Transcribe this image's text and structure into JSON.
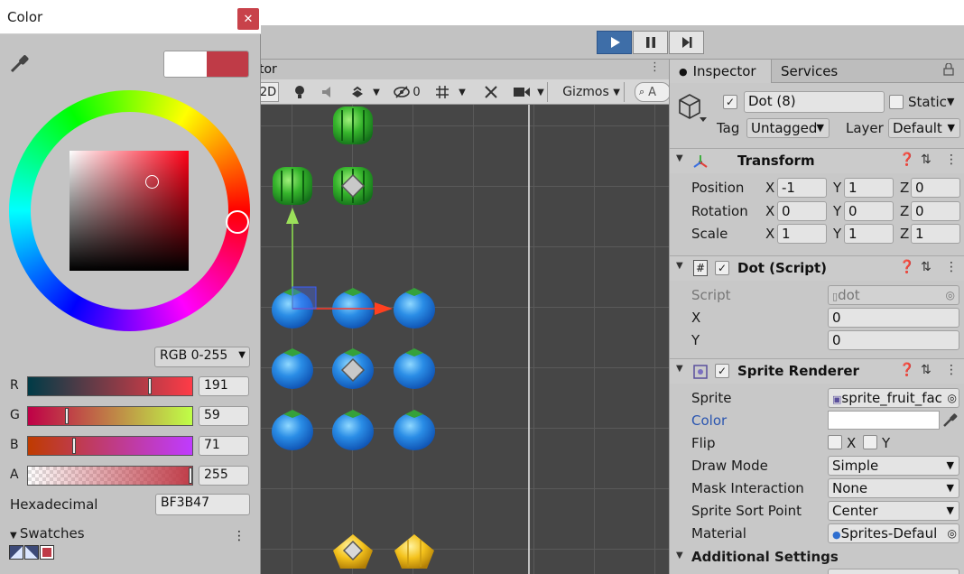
{
  "color_window": {
    "title": "Color",
    "current_color": "#BF3B47",
    "previous_color": "#FFFFFF",
    "mode": "RGB 0-255",
    "channels": [
      {
        "label": "R",
        "value": "191",
        "fraction": 0.749
      },
      {
        "label": "G",
        "value": "59",
        "fraction": 0.231
      },
      {
        "label": "B",
        "value": "71",
        "fraction": 0.278
      },
      {
        "label": "A",
        "value": "255",
        "fraction": 1.0
      }
    ],
    "hex_label": "Hexadecimal",
    "hex_value": "BF3B47",
    "swatches_label": "Swatches"
  },
  "toolbar": {
    "play": "play-icon",
    "pause": "pause-icon",
    "step": "step-icon"
  },
  "scene": {
    "tab_label": "tor",
    "mode_2d": "2D",
    "hidden_count": "0",
    "gizmos_label": "Gizmos",
    "search_letter": "A"
  },
  "inspector": {
    "tabs": [
      "Inspector",
      "Services"
    ],
    "object_name": "Dot (8)",
    "static_label": "Static",
    "tag_label": "Tag",
    "tag_value": "Untagged",
    "layer_label": "Layer",
    "layer_value": "Default",
    "transform": {
      "title": "Transform",
      "rows": [
        {
          "label": "Position",
          "x": "-1",
          "y": "1",
          "z": "0"
        },
        {
          "label": "Rotation",
          "x": "0",
          "y": "0",
          "z": "0"
        },
        {
          "label": "Scale",
          "x": "1",
          "y": "1",
          "z": "1"
        }
      ]
    },
    "dot_script": {
      "title": "Dot (Script)",
      "script_label": "Script",
      "script_value": "dot",
      "x_label": "X",
      "x_value": "0",
      "y_label": "Y",
      "y_value": "0"
    },
    "sprite_renderer": {
      "title": "Sprite Renderer",
      "sprite_label": "Sprite",
      "sprite_value": "sprite_fruit_fac",
      "color_label": "Color",
      "color_value": "#FFFFFF",
      "flip_label": "Flip",
      "flip_x": "X",
      "flip_y": "Y",
      "draw_mode_label": "Draw Mode",
      "draw_mode_value": "Simple",
      "mask_label": "Mask Interaction",
      "mask_value": "None",
      "sort_point_label": "Sprite Sort Point",
      "sort_point_value": "Center",
      "material_label": "Material",
      "material_value": "Sprites-Defaul"
    },
    "additional_settings": "Additional Settings"
  }
}
